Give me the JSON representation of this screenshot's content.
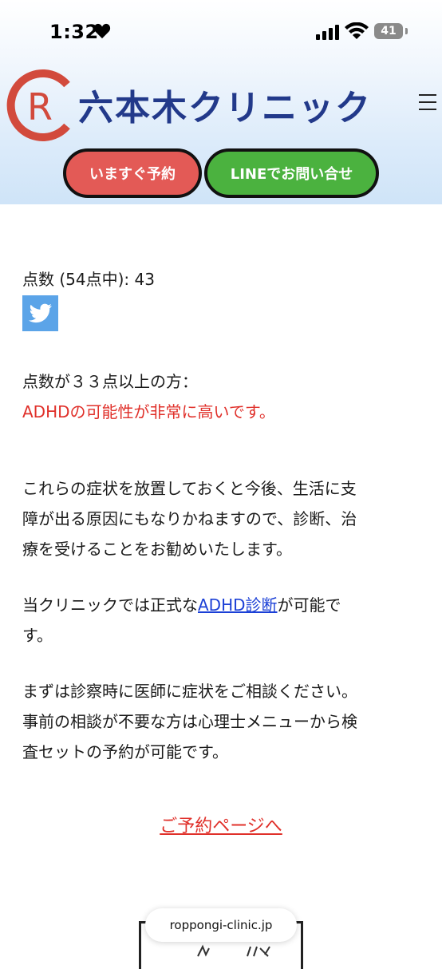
{
  "status_bar": {
    "time": "1:32",
    "battery": "41"
  },
  "header": {
    "clinic_name": "六本木クリニック",
    "reserve_button": "いますぐ予約",
    "line_button": "LINEでお問い合せ"
  },
  "result": {
    "score_text": "点数 (54点中): 43",
    "threshold_text": "点数が３３点以上の方：",
    "verdict_text": "ADHDの可能性が非常に高いです。",
    "advice_line1": "これらの症状を放置しておくと今後、生活に支",
    "advice_line2": "障が出る原因にもなりかねますので、診断、治",
    "advice_line3": "療を受けることをお勧めいたします。",
    "diag_prefix": "当クリニックでは正式な",
    "diag_link": "ADHD診断",
    "diag_suffix": "が可能で",
    "diag_line2": "す。",
    "consult_line1": "まずは診察時に医師に症状をご相談ください。",
    "consult_line2": "事前の相談が不要な方は心理士メニューから検",
    "consult_line3": "査セットの予約が可能です。",
    "cta_link": "ご予約ページへ"
  },
  "browser": {
    "url": "roppongi-clinic.jp"
  },
  "colors": {
    "brand_blue": "#22398a",
    "logo_red": "#d24a3c",
    "reserve_red": "#e35a56",
    "line_green": "#4bb23f",
    "alert_red": "#e0302a",
    "link_blue": "#1a3fd6",
    "twitter_blue": "#5ba4e8"
  },
  "icons": [
    "heart-icon",
    "signal-icon",
    "wifi-icon",
    "battery-icon",
    "clinic-logo",
    "hamburger-menu-icon",
    "twitter-icon"
  ]
}
